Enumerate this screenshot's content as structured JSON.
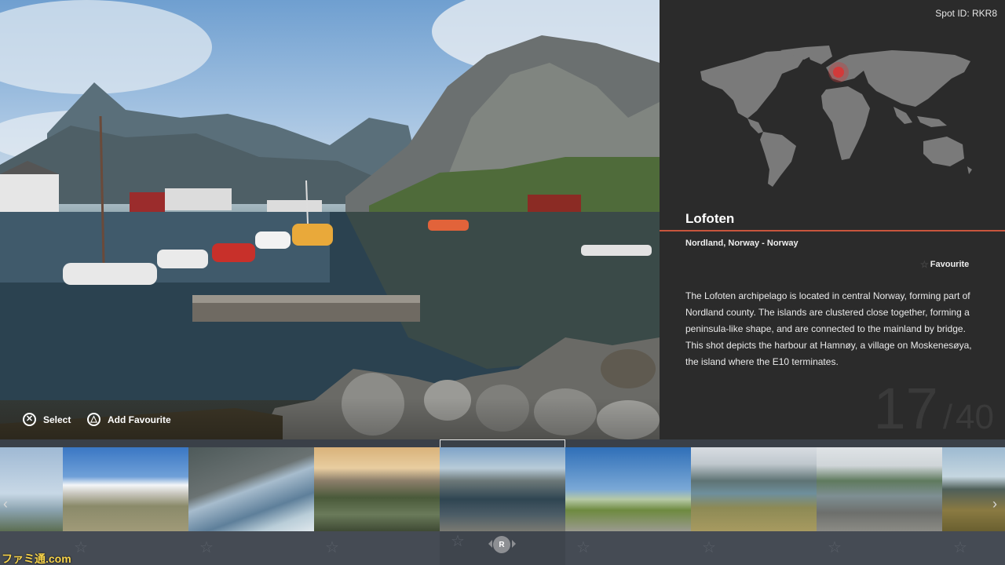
{
  "hero": {
    "select_label": "Select",
    "add_favourite_label": "Add Favourite",
    "select_icon": "cross-button-icon",
    "add_icon": "triangle-button-icon"
  },
  "panel": {
    "spot_id": "Spot ID: RKR8",
    "title": "Lofoten",
    "region": "Nordland, Norway - Norway",
    "favourite_label": "Favourite",
    "description": "The Lofoten archipelago is located in central Norway, forming part of Nordland county. The islands are clustered close together, forming a peninsula-like shape, and are connected to the mainland by bridge. This shot depicts the harbour at Hamnøy, a village on Moskenesøya, the island where the E10 terminates.",
    "counter_current": "17",
    "counter_separator": "/",
    "counter_total": "40",
    "accent_color": "#c8553d",
    "marker_color": "#d23a3a"
  },
  "filmstrip": {
    "selected_badge": "R",
    "thumbs": [
      {
        "name": "sky-coast"
      },
      {
        "name": "plateau-clouds"
      },
      {
        "name": "fjord-cliffs"
      },
      {
        "name": "atlantic-road"
      },
      {
        "name": "lofoten-harbour"
      },
      {
        "name": "open-grassland"
      },
      {
        "name": "mountain-lake"
      },
      {
        "name": "village-road"
      },
      {
        "name": "coastal-rocks"
      }
    ],
    "left_arrow": "‹",
    "right_arrow": "›"
  },
  "watermark": "ファミ通.com"
}
